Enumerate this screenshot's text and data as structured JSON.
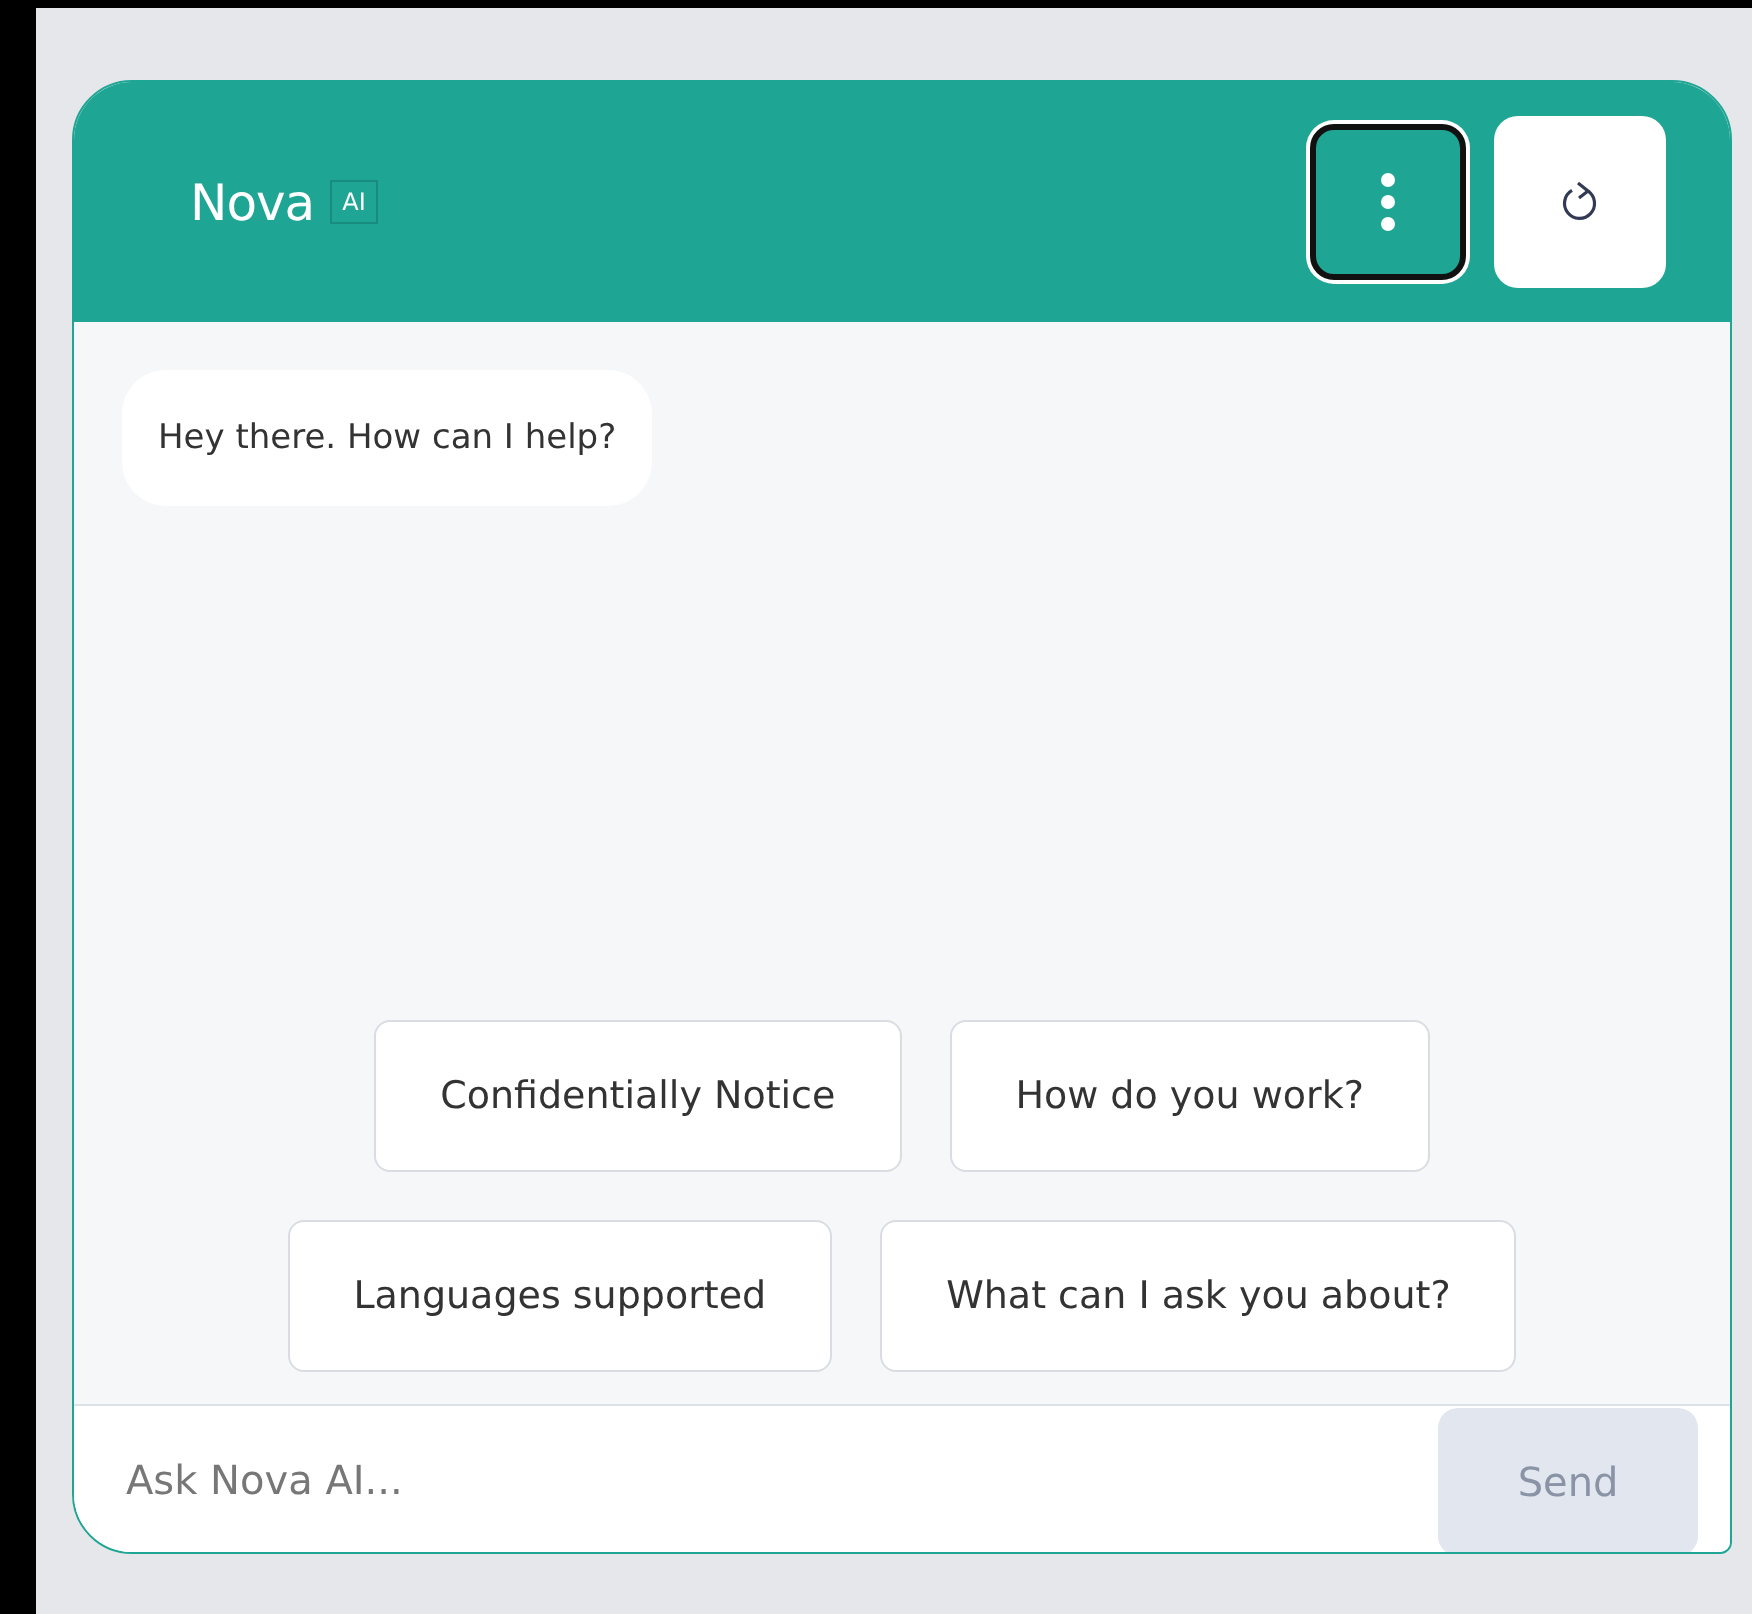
{
  "header": {
    "title": "Nova",
    "badge": "AI"
  },
  "messages": [
    {
      "text": "Hey there. How can I help?"
    }
  ],
  "suggestions": [
    [
      "Confidentially Notice",
      "How do you work?"
    ],
    [
      "Languages supported",
      "What can I ask you about?"
    ]
  ],
  "input": {
    "placeholder": "Ask Nova AI..."
  },
  "send_button": {
    "label": "Send",
    "disabled": true
  }
}
